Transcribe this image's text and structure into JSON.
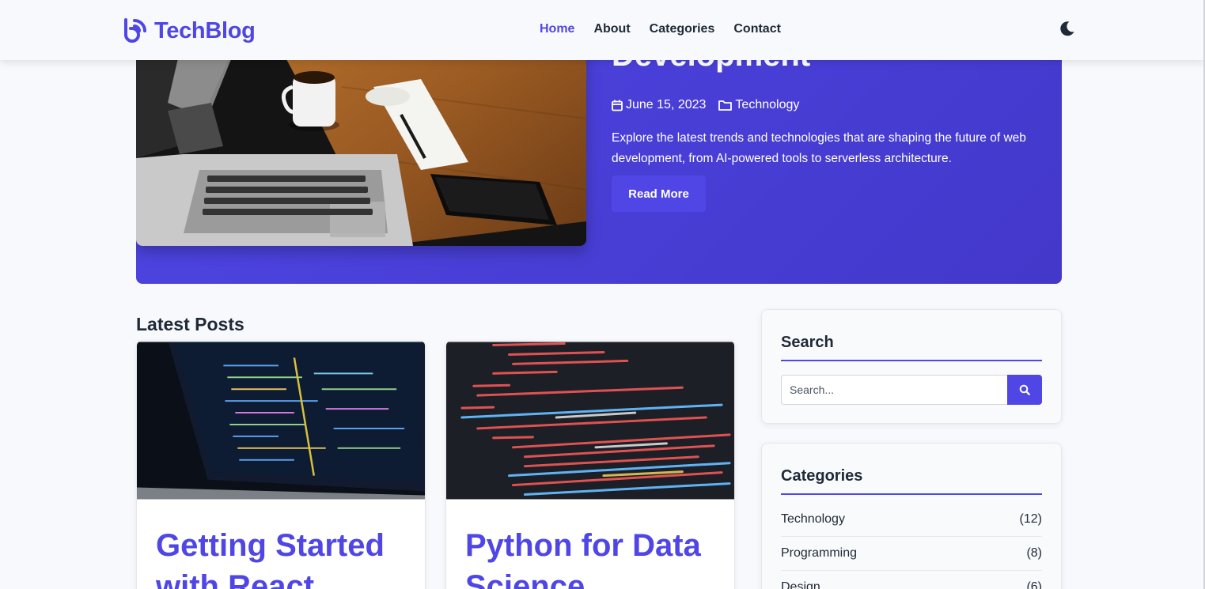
{
  "brand": {
    "name": "TechBlog",
    "color": "#4f46e5"
  },
  "nav": {
    "items": [
      {
        "label": "Home",
        "active": true
      },
      {
        "label": "About",
        "active": false
      },
      {
        "label": "Categories",
        "active": false
      },
      {
        "label": "Contact",
        "active": false
      }
    ],
    "theme_icon": "moon-icon"
  },
  "hero": {
    "title": "Development",
    "date": "June 15, 2023",
    "category": "Technology",
    "excerpt": "Explore the latest trends and technologies that are shaping the future of web development, from AI-powered tools to serverless architecture.",
    "button_label": "Read More",
    "background": "#4f46e5"
  },
  "latest": {
    "heading": "Latest Posts",
    "posts": [
      {
        "title": "Getting Started with React"
      },
      {
        "title": "Python for Data Science"
      }
    ]
  },
  "sidebar": {
    "search": {
      "title": "Search",
      "placeholder": "Search...",
      "icon": "search-icon"
    },
    "categories": {
      "title": "Categories",
      "items": [
        {
          "name": "Technology",
          "count": "(12)"
        },
        {
          "name": "Programming",
          "count": "(8)"
        },
        {
          "name": "Design",
          "count": "(6)"
        }
      ]
    }
  }
}
